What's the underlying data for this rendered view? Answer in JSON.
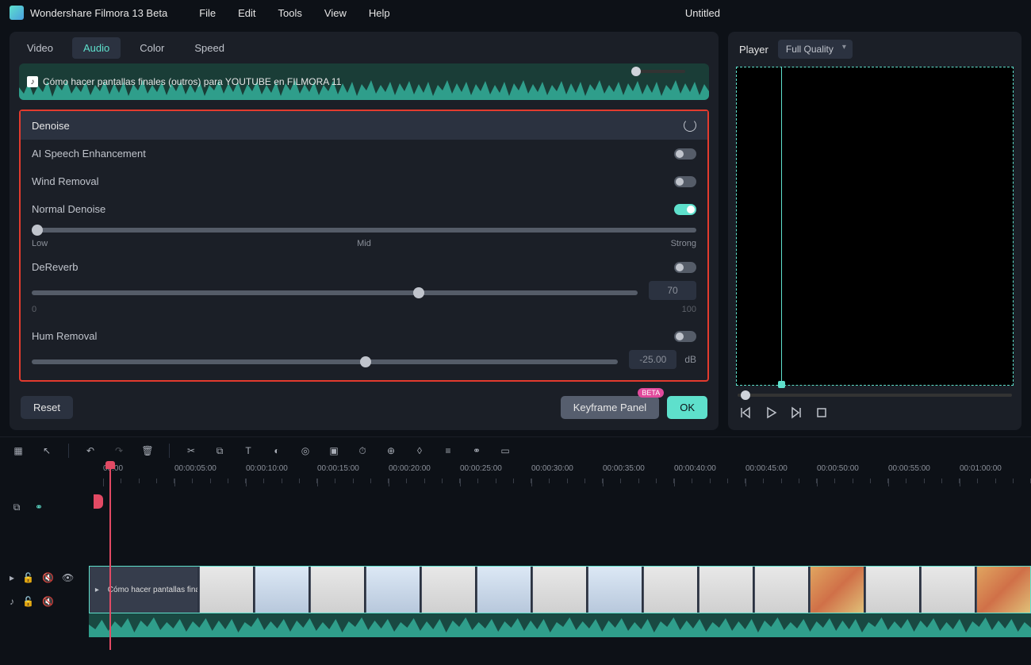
{
  "app": {
    "title": "Wondershare Filmora 13 Beta",
    "document": "Untitled"
  },
  "menu": [
    "File",
    "Edit",
    "Tools",
    "View",
    "Help"
  ],
  "tabs": {
    "items": [
      "Video",
      "Audio",
      "Color",
      "Speed"
    ],
    "active": 1
  },
  "clip": {
    "title": "Cómo hacer pantallas finales (outros) para YOUTUBE en FILMORA 11"
  },
  "denoise": {
    "header": "Denoise",
    "ai_speech": {
      "label": "AI Speech Enhancement",
      "on": false
    },
    "wind": {
      "label": "Wind Removal",
      "on": false
    },
    "normal": {
      "label": "Normal Denoise",
      "on": true,
      "low": "Low",
      "mid": "Mid",
      "strong": "Strong",
      "value": 0
    },
    "dereverb": {
      "label": "DeReverb",
      "on": false,
      "value": "70",
      "min": "0",
      "max": "100",
      "pos": 63
    },
    "hum": {
      "label": "Hum Removal",
      "on": false,
      "value": "-25.00",
      "unit": "dB",
      "pos": 56
    }
  },
  "footer": {
    "reset": "Reset",
    "keyframe": "Keyframe Panel",
    "beta": "BETA",
    "ok": "OK"
  },
  "player": {
    "title": "Player",
    "quality": "Full Quality"
  },
  "ruler": [
    "00:00",
    "00:00:05:00",
    "00:00:10:00",
    "00:00:15:00",
    "00:00:20:00",
    "00:00:25:00",
    "00:00:30:00",
    "00:00:35:00",
    "00:00:40:00",
    "00:00:45:00",
    "00:00:50:00",
    "00:00:55:00",
    "00:01:00:00"
  ],
  "timeline_clip": "Cómo hacer pantallas fina"
}
